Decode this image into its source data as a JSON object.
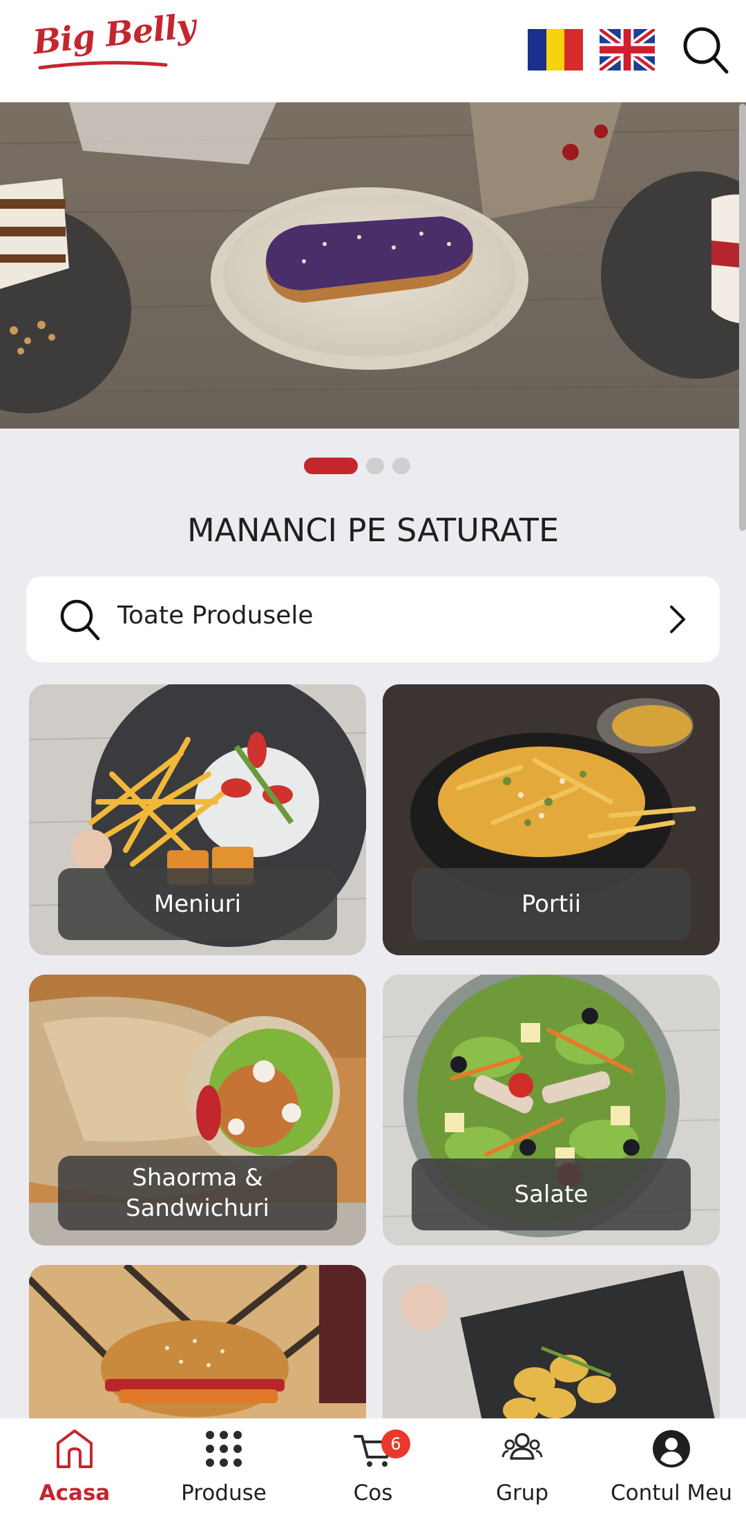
{
  "header": {
    "logo_text": "Big Belly",
    "flags": [
      "romania-flag-icon",
      "uk-flag-icon"
    ],
    "search_icon": "search-icon"
  },
  "banner": {
    "slides_total": 3,
    "active_slide": 1
  },
  "section_title": "MANANCI PE SATURATE",
  "search": {
    "label": "Toate Produsele",
    "icon": "search-icon",
    "chevron": "chevron-right-icon"
  },
  "categories": [
    {
      "label": "Meniuri"
    },
    {
      "label": "Portii"
    },
    {
      "label": "Shaorma & Sandwichuri"
    },
    {
      "label": "Salate"
    },
    {
      "label": ""
    },
    {
      "label": ""
    }
  ],
  "bottom_nav": {
    "items": [
      {
        "label": "Acasa",
        "icon": "home-icon",
        "active": true
      },
      {
        "label": "Produse",
        "icon": "grid-icon"
      },
      {
        "label": "Cos",
        "icon": "cart-icon",
        "badge": "6"
      },
      {
        "label": "Grup",
        "icon": "group-icon"
      },
      {
        "label": "Contul Meu",
        "icon": "account-icon"
      }
    ]
  },
  "colors": {
    "brand_red": "#c4262e",
    "badge_red": "#e8392c",
    "background": "#ececf0"
  }
}
